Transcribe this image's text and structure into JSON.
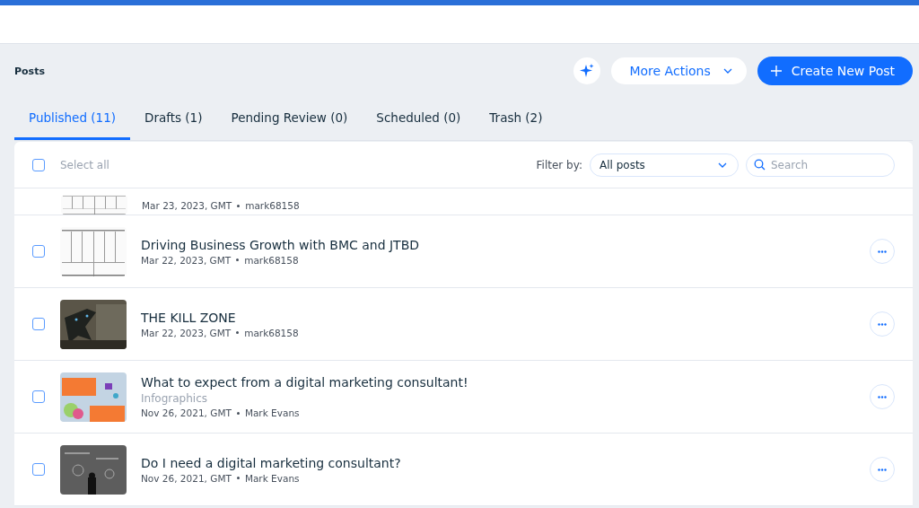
{
  "page": {
    "title": "Posts"
  },
  "actions": {
    "more_actions": "More Actions",
    "create": "Create New Post"
  },
  "tabs": [
    {
      "label": "Published (11)",
      "selected": true
    },
    {
      "label": "Drafts (1)",
      "selected": false
    },
    {
      "label": "Pending Review (0)",
      "selected": false
    },
    {
      "label": "Scheduled (0)",
      "selected": false
    },
    {
      "label": "Trash (2)",
      "selected": false
    }
  ],
  "toolbar": {
    "select_all": {
      "label": "Select all",
      "checked": false
    },
    "filter_label": "Filter by:",
    "filter_value": "All posts",
    "search": {
      "placeholder": "Search"
    }
  },
  "posts": [
    {
      "date": "Mar 23, 2023, GMT",
      "author": "mark68158",
      "cut": true
    },
    {
      "title": "Driving Business Growth with BMC and JTBD",
      "date": "Mar 22, 2023, GMT",
      "author": "mark68158",
      "checked": false
    },
    {
      "title": "THE KILL ZONE",
      "date": "Mar 22, 2023, GMT",
      "author": "mark68158",
      "checked": false
    },
    {
      "title": "What to expect from a digital marketing consultant!",
      "category": "Infographics",
      "date": "Nov 26, 2021, GMT",
      "author": "Mark Evans",
      "checked": false
    },
    {
      "title": "Do I need a digital marketing consultant?",
      "date": "Nov 26, 2021, GMT",
      "author": "Mark Evans",
      "checked": false
    }
  ]
}
